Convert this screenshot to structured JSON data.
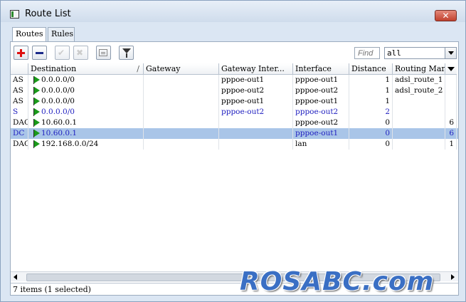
{
  "window": {
    "title": "Route List",
    "close_label": "✕"
  },
  "tabs": [
    {
      "label": "Routes",
      "active": true
    },
    {
      "label": "Rules",
      "active": false
    }
  ],
  "toolbar": {
    "find_placeholder": "Find",
    "filter_value": "all"
  },
  "columns": [
    {
      "label": ""
    },
    {
      "label": "Destination",
      "sort": "/"
    },
    {
      "label": "Gateway"
    },
    {
      "label": "Gateway Inter..."
    },
    {
      "label": "Interface"
    },
    {
      "label": "Distance"
    },
    {
      "label": "Routing Mark"
    },
    {
      "label": ""
    }
  ],
  "rows": [
    {
      "flags": "AS",
      "dst": "0.0.0.0/0",
      "gw": "",
      "gwif": "pppoe-out1",
      "iface": "pppoe-out1",
      "dist": "1",
      "mark": "adsl_route_1",
      "extra": "",
      "selected": false,
      "static": false
    },
    {
      "flags": "AS",
      "dst": "0.0.0.0/0",
      "gw": "",
      "gwif": "pppoe-out2",
      "iface": "pppoe-out2",
      "dist": "1",
      "mark": "adsl_route_2",
      "extra": "",
      "selected": false,
      "static": false
    },
    {
      "flags": "AS",
      "dst": "0.0.0.0/0",
      "gw": "",
      "gwif": "pppoe-out1",
      "iface": "pppoe-out1",
      "dist": "1",
      "mark": "",
      "extra": "",
      "selected": false,
      "static": false
    },
    {
      "flags": "S",
      "dst": "0.0.0.0/0",
      "gw": "",
      "gwif": "pppoe-out2",
      "iface": "pppoe-out2",
      "dist": "2",
      "mark": "",
      "extra": "",
      "selected": false,
      "static": true
    },
    {
      "flags": "DAC",
      "dst": "10.60.0.1",
      "gw": "",
      "gwif": "",
      "iface": "pppoe-out2",
      "dist": "0",
      "mark": "",
      "extra": "6",
      "selected": false,
      "static": false
    },
    {
      "flags": "DC",
      "dst": "10.60.0.1",
      "gw": "",
      "gwif": "",
      "iface": "pppoe-out1",
      "dist": "0",
      "mark": "",
      "extra": "6",
      "selected": true,
      "static": true
    },
    {
      "flags": "DAC",
      "dst": "192.168.0.0/24",
      "gw": "",
      "gwif": "",
      "iface": "lan",
      "dist": "0",
      "mark": "",
      "extra": "1",
      "selected": false,
      "static": false
    }
  ],
  "status": {
    "text": "7 items (1 selected)"
  },
  "watermark": {
    "text": "ROSABC.com"
  },
  "colors": {
    "selected_row": "#a9c5e8",
    "static_text": "#2020c0",
    "arrow_green": "#1a9a1a"
  }
}
